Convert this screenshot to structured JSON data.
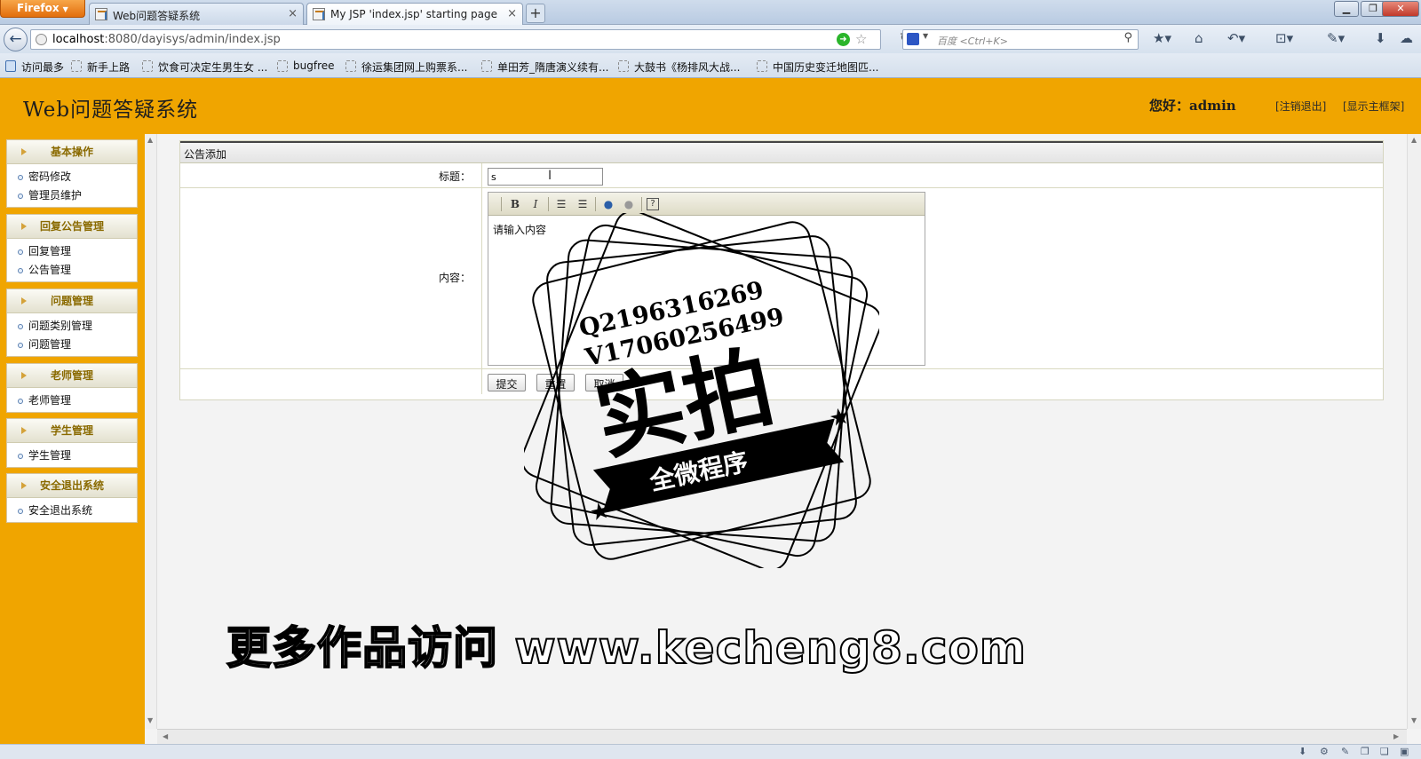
{
  "browser": {
    "app_button": "Firefox",
    "tabs": [
      {
        "label": "Web问题答疑系统",
        "active": false
      },
      {
        "label": "My JSP 'index.jsp' starting page",
        "active": true
      }
    ],
    "url_host": "localhost",
    "url_path": ":8080/dayisys/admin/index.jsp",
    "search_placeholder": "百度 <Ctrl+K>",
    "bookmarks": [
      "访问最多",
      "新手上路",
      "饮食可决定生男生女 ...",
      "bugfree",
      "徐运集团网上购票系...",
      "单田芳_隋唐演义续有...",
      "大鼓书《杨排风大战...",
      "中国历史变迁地图匹..."
    ]
  },
  "header": {
    "title": "Web问题答疑系统",
    "greeting": "您好：admin",
    "logout_link": "[注销退出]",
    "frame_link": "[显示主框架]"
  },
  "sidebar": {
    "groups": [
      {
        "title": "基本操作",
        "items": [
          "密码修改",
          "管理员维护"
        ]
      },
      {
        "title": "回复公告管理",
        "items": [
          "回复管理",
          "公告管理"
        ]
      },
      {
        "title": "问题管理",
        "items": [
          "问题类别管理",
          "问题管理"
        ]
      },
      {
        "title": "老师管理",
        "items": [
          "老师管理"
        ]
      },
      {
        "title": "学生管理",
        "items": [
          "学生管理"
        ]
      },
      {
        "title": "安全退出系统",
        "items": [
          "安全退出系统"
        ]
      }
    ]
  },
  "form": {
    "section_title": "公告添加",
    "title_label": "标题：",
    "title_value": "s",
    "content_label": "内容：",
    "content_placeholder": "请输入内容",
    "toolbar": [
      "bold",
      "italic",
      "ordered-list",
      "unordered-list",
      "link",
      "unlink",
      "help"
    ],
    "toolbar_bold": "B",
    "toolbar_italic": "I",
    "toolbar_help": "?",
    "submit": "提交",
    "reset": "重置",
    "cancel": "取消"
  },
  "watermark": {
    "qq": "Q2196316269",
    "wx": "V17060256499",
    "big": "实拍",
    "ribbon": "全微程序",
    "footer": "更多作品访问 www.kecheng8.com"
  }
}
